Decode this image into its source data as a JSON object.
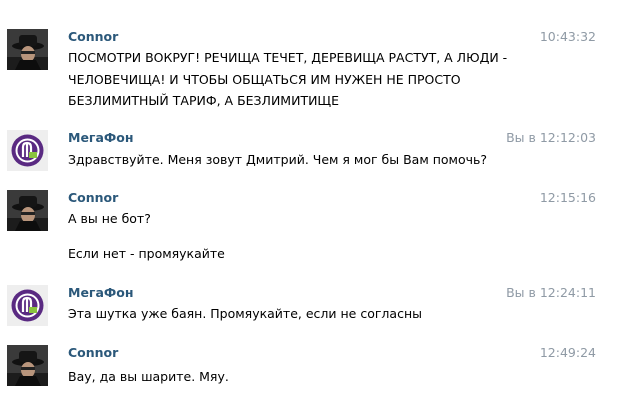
{
  "messages": [
    {
      "author": "Connor",
      "time": "10:43:32",
      "avatar_icon": "connor-avatar",
      "lines": [
        "ПОСМОТРИ ВОКРУГ! РЕЧИЩА ТЕЧЕТ, ДЕРЕВИЩА РАСТУТ, А ЛЮДИ -",
        "ЧЕЛОВЕЧИЩА! И ЧТОБЫ ОБЩАТЬСЯ ИМ НУЖЕН НЕ ПРОСТО",
        "БЕЗЛИМИТНЫЙ ТАРИФ, А БЕЗЛИМИТИЩЕ"
      ]
    },
    {
      "author": "МегаФон",
      "time": "Вы в 12:12:03",
      "avatar_icon": "megafon-logo",
      "lines": [
        "Здравствуйте. Меня зовут Дмитрий. Чем я мог бы Вам помочь?"
      ]
    },
    {
      "author": "Connor",
      "time": "12:15:16",
      "avatar_icon": "connor-avatar",
      "lines": [
        "А вы не бот?",
        "Если нет - промяукайте"
      ]
    },
    {
      "author": "МегаФон",
      "time": "Вы в 12:24:11",
      "avatar_icon": "megafon-logo",
      "lines": [
        "Эта шутка уже баян. Промяукайте, если не согласны"
      ]
    },
    {
      "author": "Connor",
      "time": "12:49:24",
      "avatar_icon": "connor-avatar",
      "lines": [
        "Вау, да вы шарите. Мяу."
      ]
    }
  ],
  "colors": {
    "author": "#2b587a",
    "time": "#8f9aa5",
    "text": "#000000",
    "megafon_purple": "#5a2a82",
    "megafon_green": "#8ac43f"
  }
}
